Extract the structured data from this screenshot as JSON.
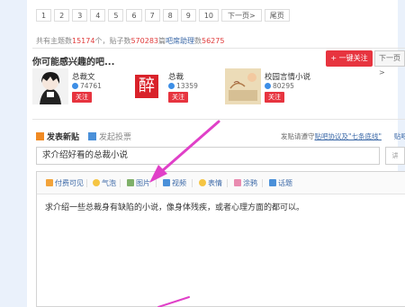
{
  "pagination": {
    "pages": [
      "1",
      "2",
      "3",
      "4",
      "5",
      "6",
      "7",
      "8",
      "9",
      "10"
    ],
    "next": "下一页>",
    "last": "尾页"
  },
  "stats": {
    "prefix": "共有主题数",
    "topics": "15174",
    "mid1": "个，贴子数",
    "posts": "570283",
    "mid2": "篇",
    "admin_label": "吧席助理",
    "admin_mid": "数",
    "admin_count": "56275"
  },
  "recommend": {
    "title": "你可能感兴趣的吧...",
    "onekey": "+ 一键关注",
    "nextpage": "下一页 >",
    "cards": [
      {
        "name": "总裁文",
        "fans": "74761",
        "follow": "关注"
      },
      {
        "name": "总裁",
        "fans": "13359",
        "follow": "关注",
        "seal_char": "醉"
      },
      {
        "name": "校园言情小说",
        "fans": "80295",
        "follow": "关注"
      }
    ]
  },
  "post": {
    "tab_new": "发表新贴",
    "tab_vote": "发起投票",
    "notice_prefix": "发贴请遵守",
    "notice_link": "贴吧协议及\"七条底线\"",
    "notice_suffix": "贴吧",
    "title_value": "求介绍好看的总裁小说",
    "side_label": "讲"
  },
  "toolbar": {
    "items": [
      "付费可见",
      "气泡",
      "图片",
      "视频",
      "表情",
      "涂鸦",
      "话题"
    ]
  },
  "editor": {
    "body": "求介绍一些总裁身有缺陷的小说，像身体残疾，或者心理方面的都可以。"
  },
  "colors": {
    "accent_red": "#e7343f",
    "link_blue": "#3d6aa8",
    "annotation_arrow": "#e040c8"
  }
}
